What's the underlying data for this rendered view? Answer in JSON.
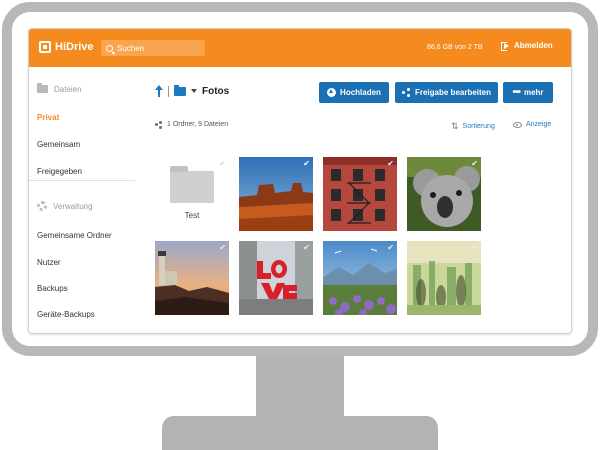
{
  "brand": {
    "name": "HiDrive",
    "accent": "#f58b1f",
    "button_blue": "#1b6fb3"
  },
  "header": {
    "search_placeholder": "Suchen",
    "quota": "86,6 GB von 2 TB",
    "logout_label": "Abmelden"
  },
  "sidebar": {
    "files_heading": "Dateien",
    "items": [
      {
        "label": "Privat",
        "active": true
      },
      {
        "label": "Gemeinsam",
        "active": false
      },
      {
        "label": "Freigegeben",
        "active": false
      }
    ],
    "admin_heading": "Verwaltung",
    "admin_items": [
      {
        "label": "Gemeinsame Ordner"
      },
      {
        "label": "Nutzer"
      },
      {
        "label": "Backups"
      },
      {
        "label": "Geräte-Backups"
      }
    ]
  },
  "toolbar": {
    "current_folder": "Fotos",
    "upload_label": "Hochladen",
    "share_label": "Freigabe bearbeiten",
    "more_label": "mehr"
  },
  "summary": {
    "counts": "1 Ordner, 9 Dateien",
    "sort_label": "Sortierung",
    "view_label": "Anzeige"
  },
  "files": {
    "folder_name": "Test",
    "photos": [
      {
        "subject": "desert-butte"
      },
      {
        "subject": "brick-building-fire-escape"
      },
      {
        "subject": "koala"
      },
      {
        "subject": "lighthouse-sunset"
      },
      {
        "subject": "love-sculpture"
      },
      {
        "subject": "flower-field-mountains"
      },
      {
        "subject": "blurred-crowd-hall"
      }
    ]
  }
}
